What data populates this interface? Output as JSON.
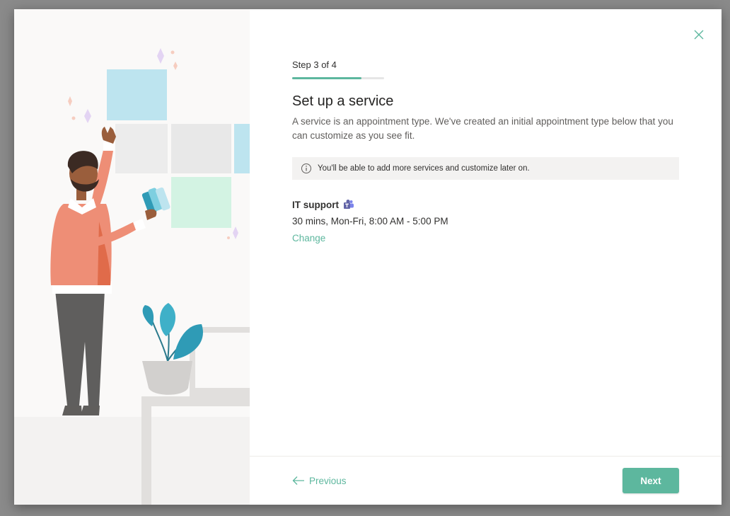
{
  "wizard": {
    "step_label": "Step 3 of 4",
    "progress_fraction": 0.75,
    "title": "Set up a service",
    "description": "A service is an appointment type. We've created an initial appointment type below that you can customize as you see fit.",
    "info_text": "You'll be able to add more services and customize later on."
  },
  "service": {
    "name": "IT support",
    "details": "30 mins, Mon-Fri, 8:00 AM - 5:00 PM",
    "change_label": "Change",
    "icon": "teams-icon"
  },
  "footer": {
    "previous_label": "Previous",
    "next_label": "Next"
  },
  "icons": {
    "close": "close-icon",
    "info": "info-icon",
    "previous": "arrow-left-icon"
  },
  "colors": {
    "accent": "#5db79e",
    "progress_track": "#e6e6e6",
    "info_bar": "#f3f2f1",
    "teams": "#6264a7"
  }
}
